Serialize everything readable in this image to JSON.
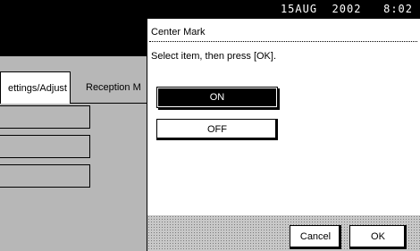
{
  "status_bar": {
    "datetime": "15AUG  2002   8:02"
  },
  "background": {
    "tabs": [
      {
        "label": "ettings/Adjust"
      },
      {
        "label": "Reception M"
      }
    ]
  },
  "dialog": {
    "title": "Center Mark",
    "instruction": "Select item, then press [OK].",
    "options": [
      {
        "label": "ON",
        "selected": true
      },
      {
        "label": "OFF",
        "selected": false
      }
    ],
    "cancel_label": "Cancel",
    "ok_label": "OK"
  },
  "colors": {
    "selected_fill": "#000000",
    "panel_gray": "#b7b7b7"
  }
}
